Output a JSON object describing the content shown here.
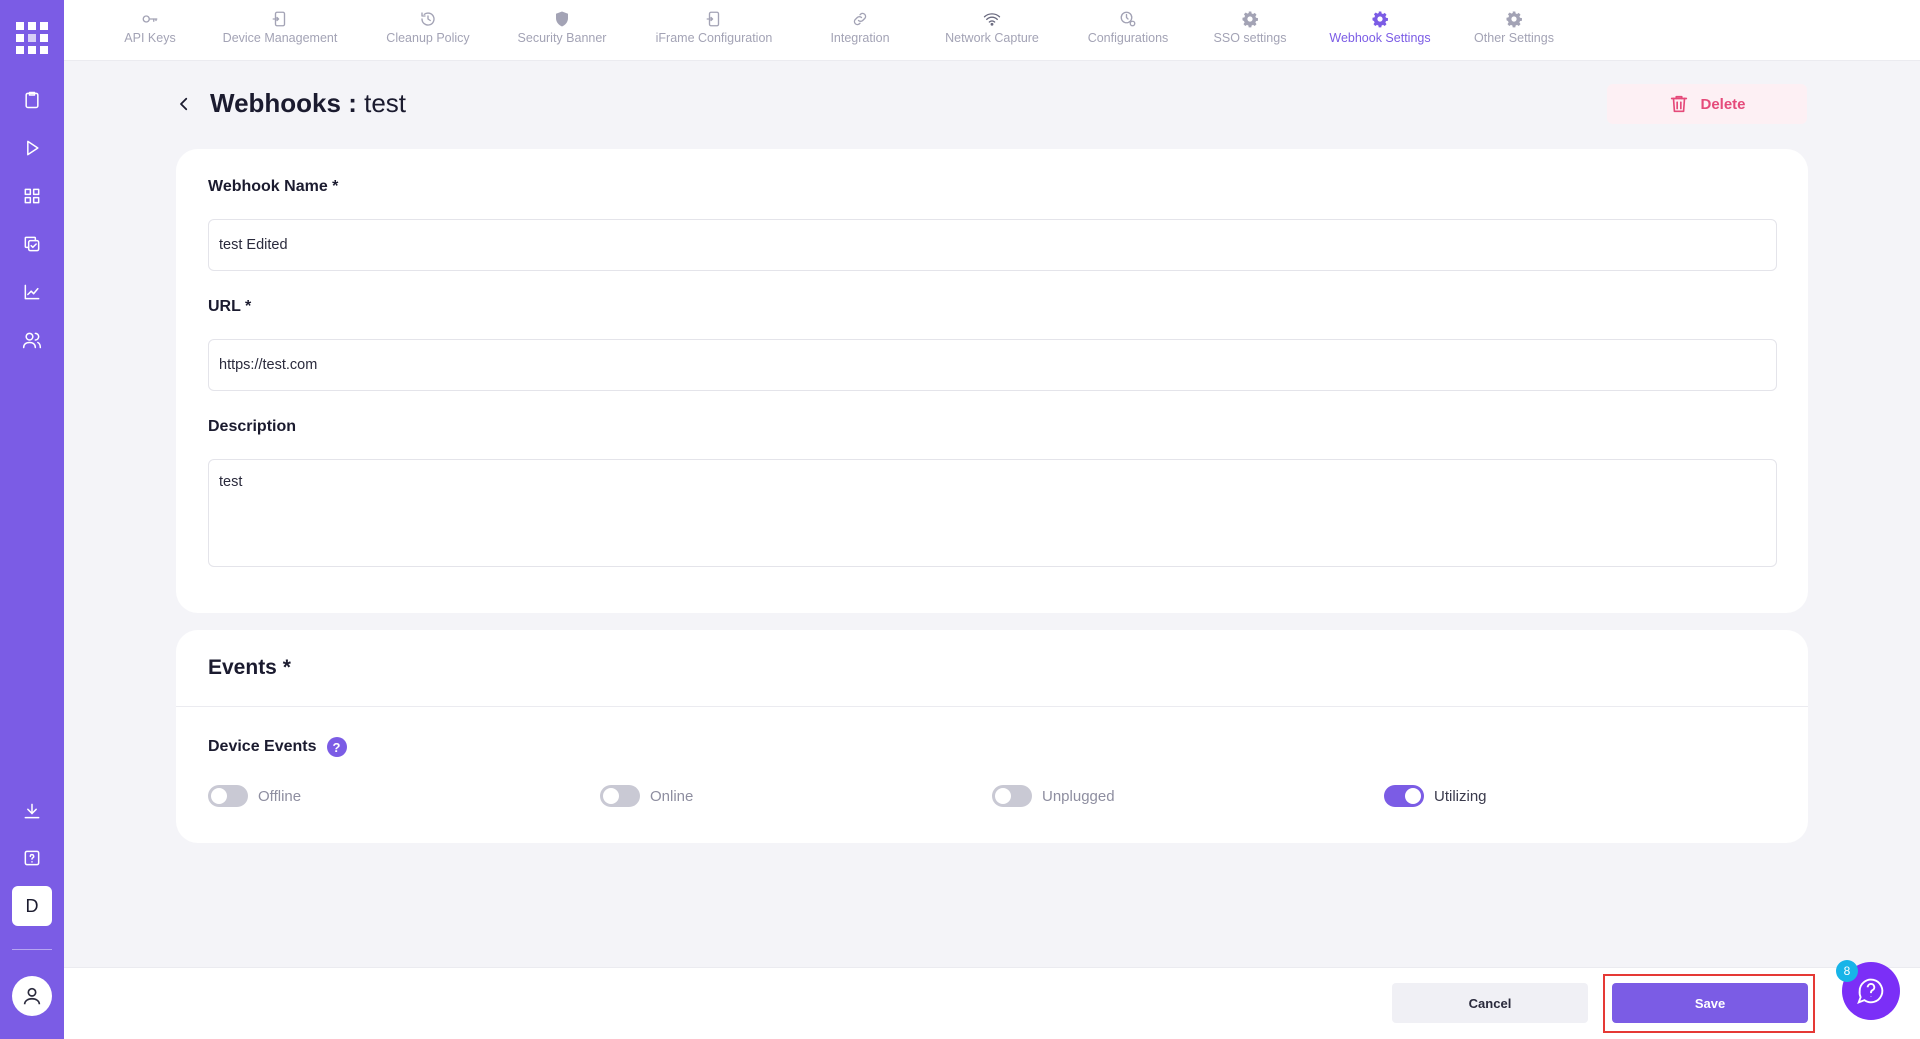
{
  "nav": {
    "tabs": [
      {
        "label": "API Keys",
        "icon": "key-icon"
      },
      {
        "label": "Device Management",
        "icon": "device-icon"
      },
      {
        "label": "Cleanup Policy",
        "icon": "history-icon"
      },
      {
        "label": "Security Banner",
        "icon": "shield-icon"
      },
      {
        "label": "iFrame Configuration",
        "icon": "device-icon"
      },
      {
        "label": "Integration",
        "icon": "link-icon"
      },
      {
        "label": "Network Capture",
        "icon": "wifi-icon"
      },
      {
        "label": "Configurations",
        "icon": "clock-gear-icon"
      },
      {
        "label": "SSO settings",
        "icon": "gear-icon"
      },
      {
        "label": "Webhook Settings",
        "icon": "gear-icon",
        "active": true
      },
      {
        "label": "Other Settings",
        "icon": "gear-icon"
      }
    ]
  },
  "header": {
    "title_prefix": "Webhooks : ",
    "title_name": "test",
    "delete_label": "Delete"
  },
  "form": {
    "name_label": "Webhook Name *",
    "name_value": "test Edited",
    "url_label": "URL *",
    "url_value": "https://test.com",
    "description_label": "Description",
    "description_value": "test"
  },
  "events": {
    "title": "Events *",
    "device_events_label": "Device Events",
    "help_glyph": "?",
    "toggles": [
      {
        "label": "Offline",
        "on": false
      },
      {
        "label": "Online",
        "on": false
      },
      {
        "label": "Unplugged",
        "on": false
      },
      {
        "label": "Utilizing",
        "on": true
      }
    ]
  },
  "sidebar": {
    "workspace_initial": "D",
    "icons": [
      "clipboard-icon",
      "play-icon",
      "grid-icon",
      "copy-check-icon",
      "chart-line-icon",
      "users-icon",
      "download-icon",
      "help-square-icon"
    ]
  },
  "footer": {
    "cancel_label": "Cancel",
    "save_label": "Save"
  },
  "help_fab": {
    "badge_count": "8"
  },
  "colors": {
    "accent": "#7b5ce5",
    "delete": "#e54a7a",
    "highlight": "#e53935",
    "help_fab": "#7b2ff7",
    "badge": "#17b4e8"
  }
}
